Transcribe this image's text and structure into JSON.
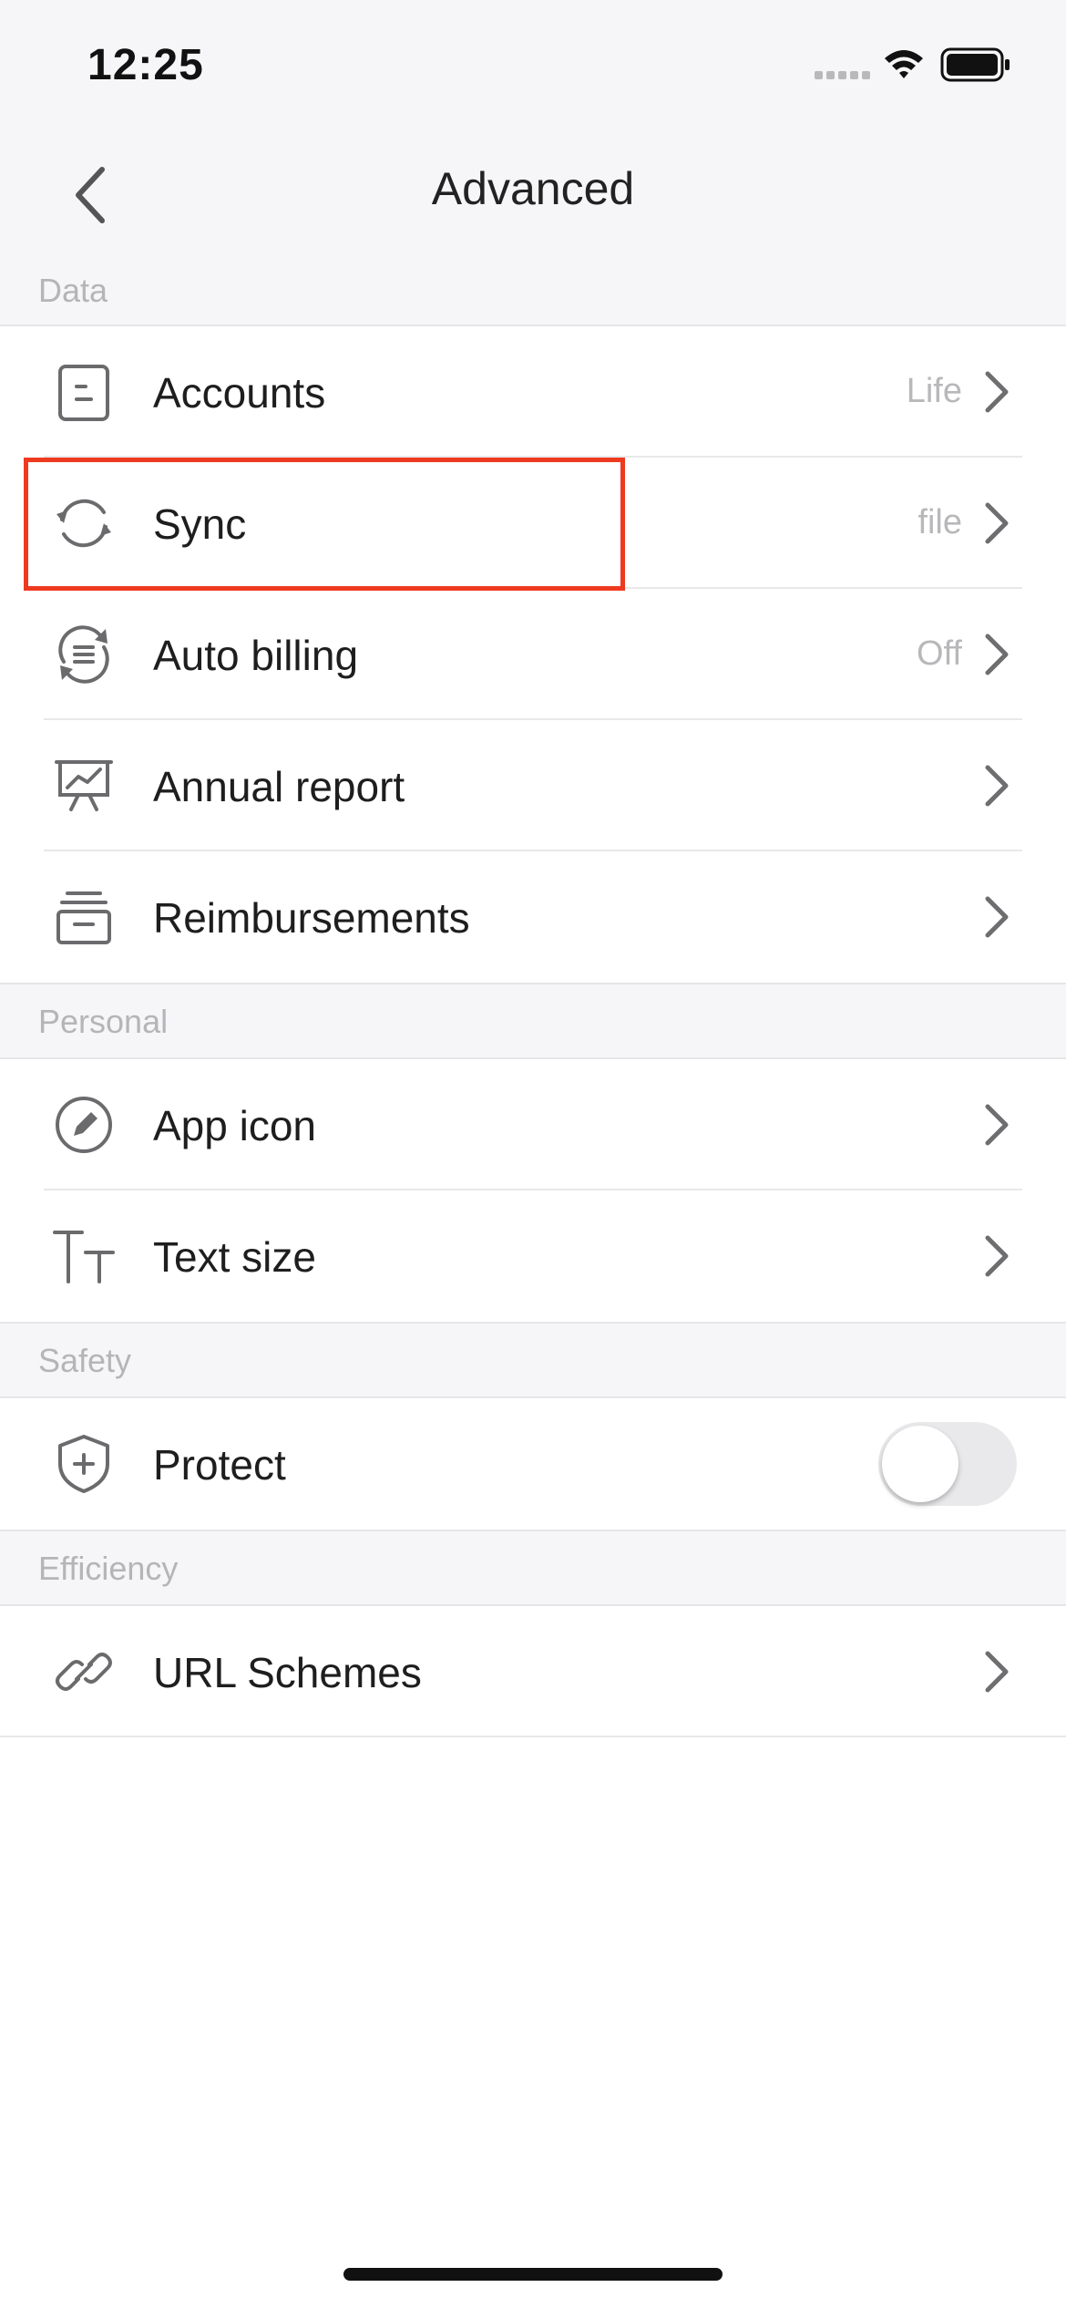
{
  "status_bar": {
    "time": "12:25"
  },
  "nav": {
    "title": "Advanced"
  },
  "sections": {
    "data": {
      "header": "Data",
      "rows": {
        "accounts": {
          "label": "Accounts",
          "value": "Life",
          "icon": "wallet-icon"
        },
        "sync": {
          "label": "Sync",
          "value": "file",
          "icon": "sync-icon"
        },
        "auto_billing": {
          "label": "Auto billing",
          "value": "Off",
          "icon": "auto-billing-icon"
        },
        "annual_report": {
          "label": "Annual report",
          "icon": "presentation-chart-icon"
        },
        "reimbursements": {
          "label": "Reimbursements",
          "icon": "reimbursement-tray-icon"
        }
      }
    },
    "personal": {
      "header": "Personal",
      "rows": {
        "app_icon": {
          "label": "App icon",
          "icon": "pencil-circle-icon"
        },
        "text_size": {
          "label": "Text size",
          "icon": "text-size-icon"
        }
      }
    },
    "safety": {
      "header": "Safety",
      "rows": {
        "protect": {
          "label": "Protect",
          "icon": "shield-plus-icon",
          "toggle_on": false
        }
      }
    },
    "efficiency": {
      "header": "Efficiency",
      "rows": {
        "url_schemes": {
          "label": "URL Schemes",
          "icon": "link-icon"
        }
      }
    }
  },
  "colors": {
    "highlight": "#ee3a1f",
    "section_bg": "#f6f6f8",
    "icon": "#6b6b6e",
    "value_text": "#b8b8bb"
  }
}
